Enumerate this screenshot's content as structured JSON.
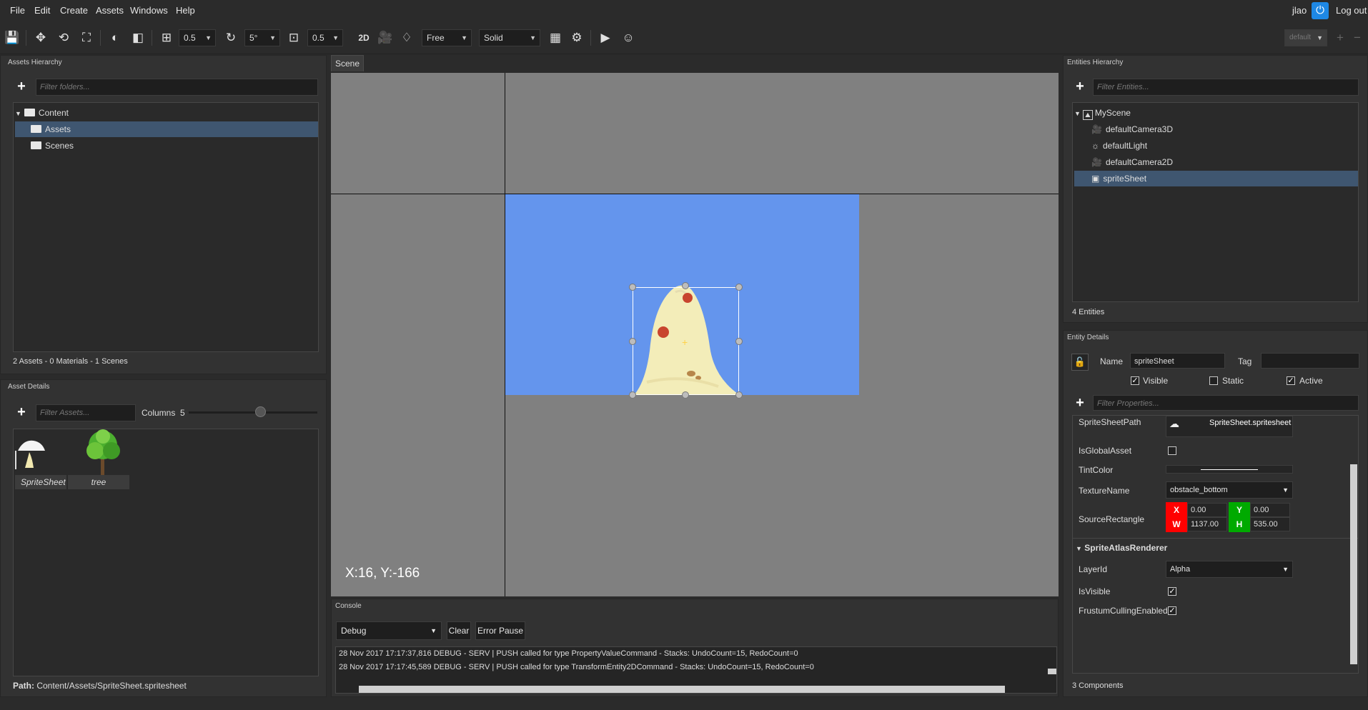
{
  "menu": {
    "items": [
      "File",
      "Edit",
      "Create",
      "Assets",
      "Windows",
      "Help"
    ]
  },
  "user": {
    "name": "jlao",
    "logout": "Log out"
  },
  "toolbar": {
    "translate_snap": "0.5",
    "rotate_snap": "5°",
    "scale_snap": "0.5",
    "mode_2d": "2D",
    "camera_mode": "Free",
    "render_mode": "Solid",
    "layout": "default"
  },
  "assets_hierarchy": {
    "title": "Assets Hierarchy",
    "filter_placeholder": "Filter folders...",
    "tree": {
      "root": "Content",
      "children": [
        "Assets",
        "Scenes"
      ]
    },
    "status": "2 Assets - 0 Materials - 1 Scenes"
  },
  "asset_details": {
    "title": "Asset Details",
    "filter_placeholder": "Filter Assets...",
    "columns_label": "Columns",
    "columns_value": "5",
    "items": [
      {
        "name": "SpriteSheet",
        "icon": "spritesheet-thumbnail"
      },
      {
        "name": "tree",
        "icon": "tree-thumbnail"
      }
    ],
    "path_label": "Path:",
    "path_value": "Content/Assets/SpriteSheet.spritesheet"
  },
  "scene": {
    "tab": "Scene",
    "coords": "X:16, Y:-166",
    "background_color": "#6495ED",
    "viewport_color": "#808080"
  },
  "console": {
    "title": "Console",
    "level": "Debug",
    "clear": "Clear",
    "error_pause": "Error Pause",
    "lines": [
      "28 Nov 2017 17:17:37,816 DEBUG - SERV   | PUSH called for type PropertyValueCommand - Stacks: UndoCount=15, RedoCount=0",
      "28 Nov 2017 17:17:45,589 DEBUG - SERV   | PUSH called for type TransformEntity2DCommand - Stacks: UndoCount=15, RedoCount=0"
    ]
  },
  "entities": {
    "title": "Entities Hierarchy",
    "filter_placeholder": "Filter Entities...",
    "root": "MyScene",
    "items": [
      {
        "name": "defaultCamera3D",
        "icon": "camera-icon"
      },
      {
        "name": "defaultLight",
        "icon": "light-icon"
      },
      {
        "name": "defaultCamera2D",
        "icon": "camera-icon"
      },
      {
        "name": "spriteSheet",
        "icon": "sprite-icon"
      }
    ],
    "status": "4 Entities"
  },
  "entity_details": {
    "title": "Entity Details",
    "name_label": "Name",
    "name_value": "spriteSheet",
    "tag_label": "Tag",
    "tag_value": "",
    "visible": {
      "label": "Visible",
      "checked": true
    },
    "static": {
      "label": "Static",
      "checked": false
    },
    "active": {
      "label": "Active",
      "checked": true
    },
    "filter_placeholder": "Filter Properties...",
    "props": {
      "spritesheet_path_label": "SpriteSheetPath",
      "spritesheet_path_value": "SpriteSheet.spritesheet",
      "is_global_label": "IsGlobalAsset",
      "is_global_checked": false,
      "tint_label": "TintColor",
      "tint_value": "#FFFFFF",
      "texture_label": "TextureName",
      "texture_value": "obstacle_bottom",
      "source_rect_label": "SourceRectangle",
      "x_label": "X",
      "x_value": "0.00",
      "y_label": "Y",
      "y_value": "0.00",
      "w_label": "W",
      "w_value": "1137.00",
      "h_label": "H",
      "h_value": "535.00",
      "x_color": "#FF0000",
      "y_color": "#00AA00"
    },
    "renderer": {
      "title": "SpriteAtlasRenderer",
      "layer_label": "LayerId",
      "layer_value": "Alpha",
      "is_visible_label": "IsVisible",
      "is_visible_checked": true,
      "frustum_label": "FrustumCullingEnabled",
      "frustum_checked": true
    },
    "status": "3 Components"
  }
}
